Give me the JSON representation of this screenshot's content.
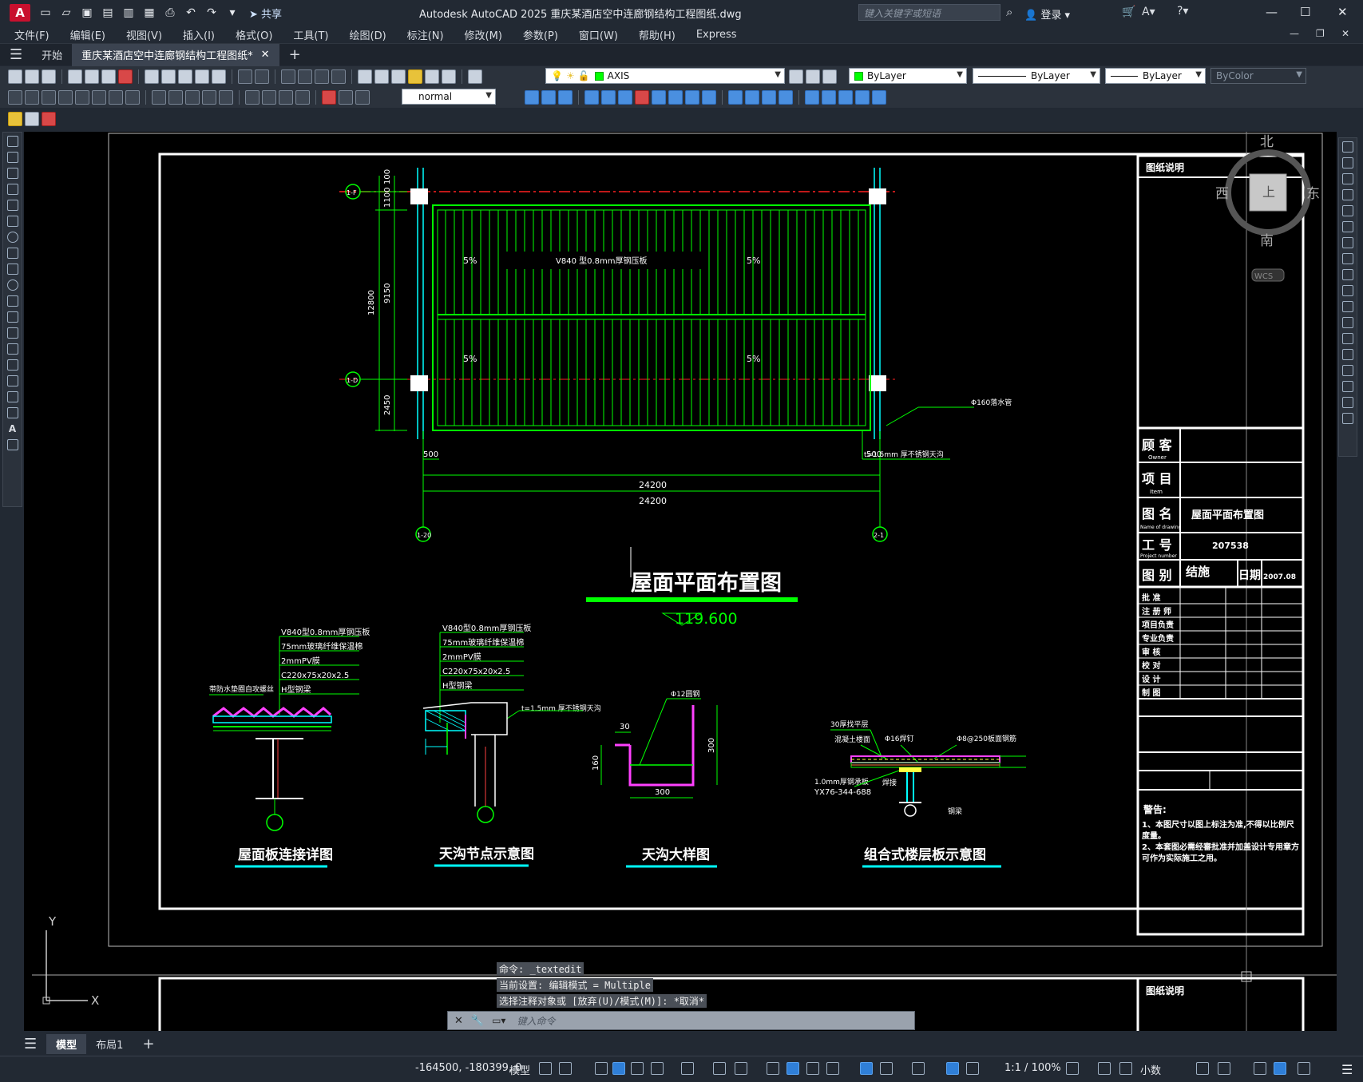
{
  "app": {
    "window_title": "Autodesk AutoCAD 2025    重庆某酒店空中连廊钢结构工程图纸.dwg",
    "search_placeholder": "键入关键字或短语",
    "login_label": "登录",
    "share_label": "共享",
    "logo_letter": "A"
  },
  "menu": [
    "文件(F)",
    "编辑(E)",
    "视图(V)",
    "插入(I)",
    "格式(O)",
    "工具(T)",
    "绘图(D)",
    "标注(N)",
    "修改(M)",
    "参数(P)",
    "窗口(W)",
    "帮助(H)",
    "Express"
  ],
  "tabs": [
    {
      "label": "开始"
    },
    {
      "label": "重庆某酒店空中连廊钢结构工程图纸*"
    }
  ],
  "toolbar": {
    "layer_name": "AXIS",
    "color_value": "ByLayer",
    "linetype_value": "ByLayer",
    "lineweight_value": "ByLayer",
    "plotstyle_value": "ByColor",
    "textstyle_value": "normal"
  },
  "viewcube": {
    "north": "北",
    "south": "南",
    "east": "东",
    "west": "西",
    "top": "上",
    "wcs": "WCS"
  },
  "drawing": {
    "plan_title": "屋面平面布置图",
    "elevation": "119.600",
    "deck_label": "V840 型0.8mm厚钢压板",
    "slope": "5%",
    "dim_12800": "12800",
    "dim_9150": "9150",
    "dim_1100": "1100",
    "dim_100": "100",
    "dim_2450": "2450",
    "dim_500": "500",
    "dim_24200": "24200",
    "grid_1f": "1-F",
    "grid_1d": "1-D",
    "grid_1_20": "1-20",
    "grid_2_1": "2-1",
    "drain_label": "Φ160落水管",
    "gutter_label": "t=1.5mm 厚不锈钢天沟",
    "detail1": {
      "title": "屋面板连接详图",
      "labels": [
        "V840型0.8mm厚钢压板",
        "75mm玻璃纤维保温棉",
        "2mmPV膜",
        "C220x75x20x2.5",
        "H型钢梁"
      ],
      "side_label": "带防水垫圈自攻螺丝"
    },
    "detail2": {
      "title": "天沟节点示意图",
      "labels": [
        "V840型0.8mm厚钢压板",
        "75mm玻璃纤维保温棉",
        "2mmPV膜",
        "C220x75x20x2.5",
        "H型钢梁"
      ],
      "side_label": "t=1.5mm 厚不锈钢天沟"
    },
    "detail3": {
      "title": "天沟大样图",
      "rebar": "Φ12圆钢",
      "dim_30": "30",
      "dim_160": "160",
      "dim_300a": "300",
      "dim_300b": "300"
    },
    "detail4": {
      "title": "组合式楼层板示意图",
      "labels": [
        "30厚找平层",
        "混凝土楼面",
        "Φ16焊钉",
        "Φ8@250板面钢筋",
        "1.0mm厚钢承板",
        "YX76-344-688",
        "焊接",
        "钢梁"
      ]
    }
  },
  "title_block": {
    "header": "图纸说明",
    "rows": [
      {
        "cn": "顾 客",
        "en": "Owner",
        "val": ""
      },
      {
        "cn": "项 目",
        "en": "Item",
        "val": ""
      },
      {
        "cn": "图 名",
        "en": "Name of drawing",
        "val": "屋面平面布置图"
      },
      {
        "cn": "工 号",
        "en": "Project number",
        "val": "207538"
      }
    ],
    "category_cn": "图 别",
    "category_val": "结施",
    "date_cn": "日期",
    "date_val": "2007.08",
    "signoffs": [
      "批 准",
      "注 册 师",
      "项目负责",
      "专业负责",
      "审 核",
      "校 对",
      "设 计",
      "制 图"
    ],
    "notice_title": "警告:",
    "notes": [
      "1、本图尺寸以图上标注为准,不得以比例尺度量。",
      "2、本套图必需经審批准并加盖设计专用章方可作为实际施工之用。"
    ]
  },
  "command": {
    "history": [
      "命令: _textedit",
      "当前设置: 编辑模式 = Multiple",
      "选择注释对象或 [放弃(U)/模式(M)]: *取消*"
    ],
    "placeholder": "键入命令"
  },
  "layout_tabs": [
    "模型",
    "布局1"
  ],
  "status": {
    "coords": "-164500, -180399, 0",
    "model_label": "模型",
    "scale": "1:1 / 100%",
    "units": "小数"
  },
  "colors": {
    "accent": "#00ff00",
    "background": "#000000",
    "chrome": "#222933",
    "highlight": "#00ffff"
  }
}
